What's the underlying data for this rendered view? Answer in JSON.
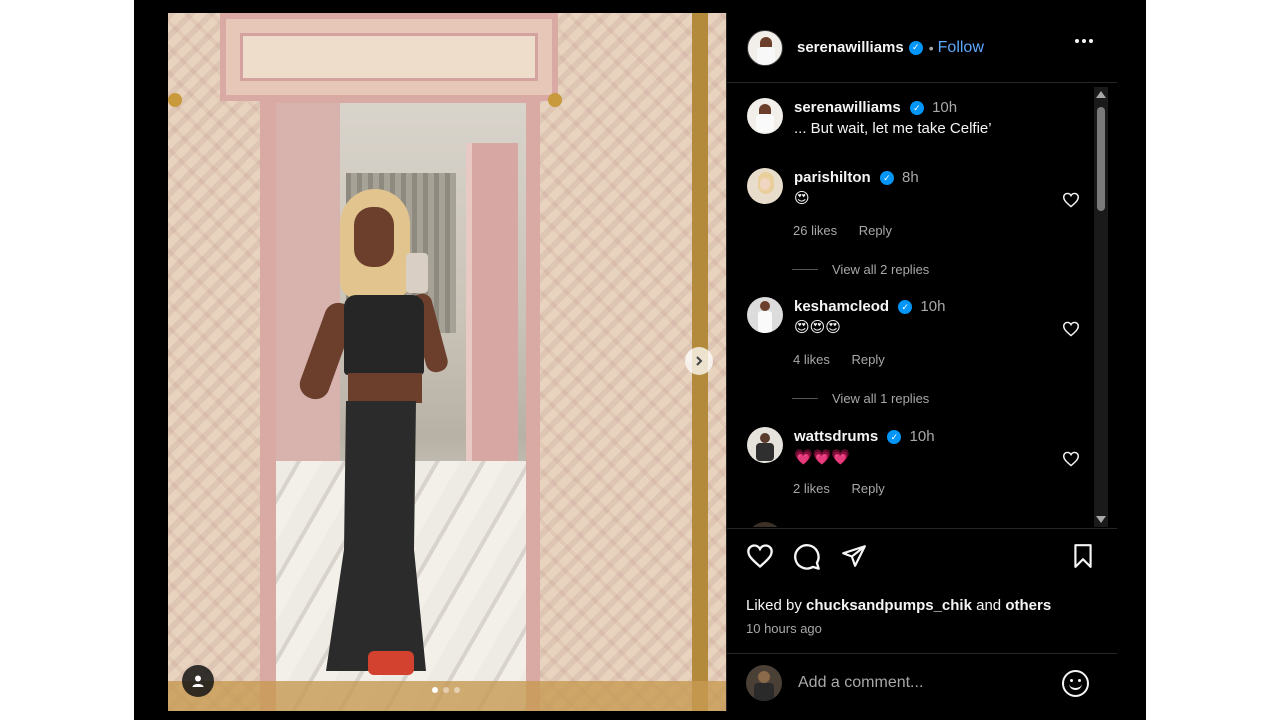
{
  "post": {
    "author": "serenawilliams",
    "follow_label": "Follow",
    "separator": "•",
    "caption_author": "serenawilliams",
    "caption_time": "10h",
    "caption_text": "... But wait, let me take Celfie’",
    "carousel": {
      "slide_count": 3,
      "active_slide": 1
    }
  },
  "comments": [
    {
      "user": "parishilton",
      "verified": true,
      "time": "8h",
      "text": "😍",
      "likes": "26 likes",
      "reply_label": "Reply",
      "view_replies": "View all 2 replies"
    },
    {
      "user": "keshamcleod",
      "verified": true,
      "time": "10h",
      "text": "😍😍😍",
      "likes": "4 likes",
      "reply_label": "Reply",
      "view_replies": "View all 1 replies"
    },
    {
      "user": "wattsdrums",
      "verified": true,
      "time": "10h",
      "text": "💗💗💗",
      "likes": "2 likes",
      "reply_label": "Reply"
    }
  ],
  "footer": {
    "liked_by_prefix": "Liked by",
    "liked_by_user": "chucksandpumps_chik",
    "liked_by_and": "and",
    "liked_by_others": "others",
    "time_ago": "10 hours ago",
    "add_comment_placeholder": "Add a comment..."
  },
  "icons": {
    "verified": "verified-badge-icon",
    "more": "more-options-icon",
    "like": "heart-icon",
    "comment": "comment-icon",
    "share": "share-icon",
    "save": "bookmark-icon",
    "emoji": "emoji-icon",
    "next": "chevron-right-icon",
    "tag": "user-tag-icon"
  },
  "colors": {
    "background": "#000000",
    "link": "#5ea9ff",
    "verified": "#0095f6",
    "secondary_text": "#a8a8a8"
  }
}
